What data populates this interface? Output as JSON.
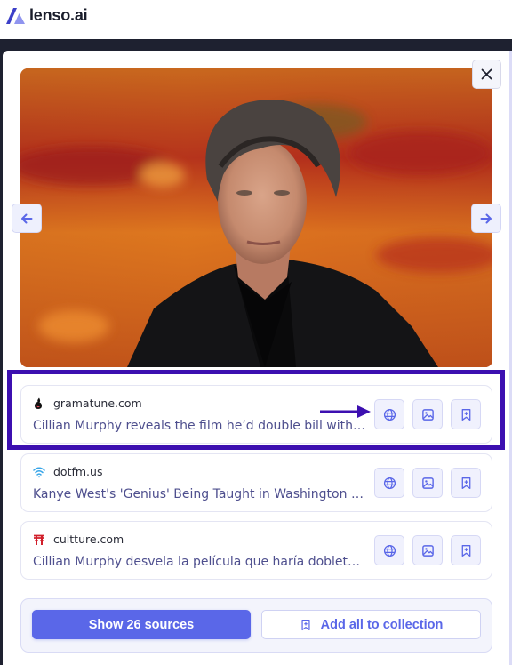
{
  "app": {
    "name": "lenso.ai"
  },
  "modal": {
    "close_icon": "close-icon",
    "prev_icon": "arrow-left-icon",
    "next_icon": "arrow-right-icon",
    "image_alt": "Portrait of a man with dark hair wearing a black suit against an orange-red blurred background"
  },
  "results": [
    {
      "domain": "gramatune.com",
      "favicon": "gramatune-favicon",
      "title": "Cillian Murphy reveals the film he’d double bill with ‘Oppenheimer’",
      "title_visible": "Cillian Murphy reveals the film he’d double bill with ‘Op…",
      "highlighted": true,
      "actions": [
        "globe-icon",
        "image-icon",
        "bookmark-add-icon"
      ]
    },
    {
      "domain": "dotfm.us",
      "favicon": "wifi-favicon",
      "title": "Kanye West's 'Genius' Being Taught in Washington Uni…",
      "title_visible": "Kanye West's 'Genius' Being Taught in Washington Uni…",
      "highlighted": false,
      "actions": [
        "globe-icon",
        "image-icon",
        "bookmark-add-icon"
      ]
    },
    {
      "domain": "cultture.com",
      "favicon": "cultture-favicon",
      "title": "Cillian Murphy desvela la película que haría doblete co…",
      "title_visible": "Cillian Murphy desvela la película que haría doblete co…",
      "highlighted": false,
      "actions": [
        "globe-icon",
        "image-icon",
        "bookmark-add-icon"
      ]
    }
  ],
  "footer": {
    "show_sources_label": "Show 26 sources",
    "add_all_label": "Add all to collection"
  },
  "colors": {
    "accent": "#5a67e8",
    "highlight_border": "#3c0fb0",
    "title_text": "#4e4f8e",
    "dark_band": "#1e2130"
  }
}
